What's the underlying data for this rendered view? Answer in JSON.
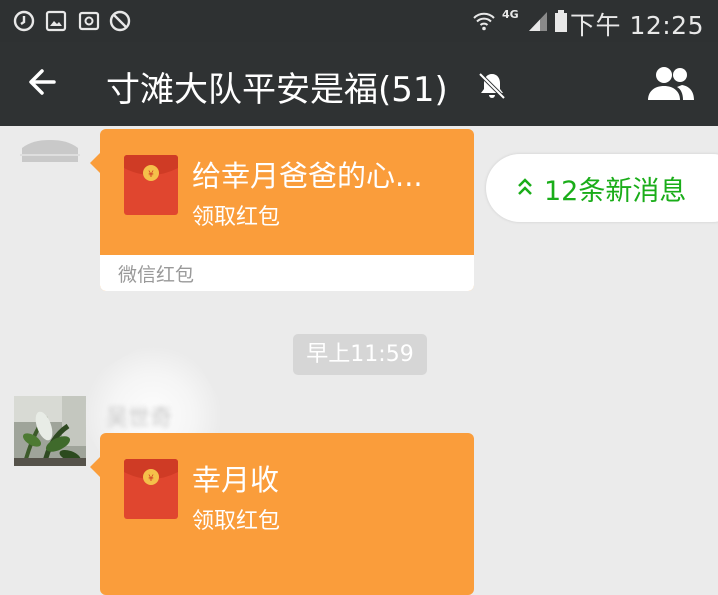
{
  "status_bar": {
    "network_label": "4G",
    "time": "下午 12:25",
    "left_icons": [
      "sync-icon",
      "image-icon",
      "cast-icon",
      "no-alarm-icon"
    ],
    "right_icons": [
      "wifi-icon",
      "signal-icon",
      "battery-icon"
    ]
  },
  "header": {
    "title": "寸滩大队平安是福(51)",
    "back_icon": "arrow-left-icon",
    "mute_icon": "bell-muted-icon",
    "members_icon": "group-members-icon"
  },
  "new_messages_pill": {
    "label": "12条新消息"
  },
  "messages": [
    {
      "type": "red_packet",
      "title": "给幸月爸爸的心...",
      "action": "领取红包",
      "footer": "微信红包"
    },
    {
      "type": "timestamp",
      "text": "早上11:59"
    },
    {
      "type": "red_packet",
      "sender": "吴世奇",
      "title": "幸月收",
      "action": "领取红包"
    }
  ],
  "colors": {
    "status_bar": "#2e3132",
    "title_bar": "#2f3233",
    "chat_bg": "#ebebeb",
    "red_packet": "#fa9d3b",
    "envelope": "#e0462f",
    "accent_green": "#1aad19",
    "timestamp_bg": "#d6d6d6"
  }
}
